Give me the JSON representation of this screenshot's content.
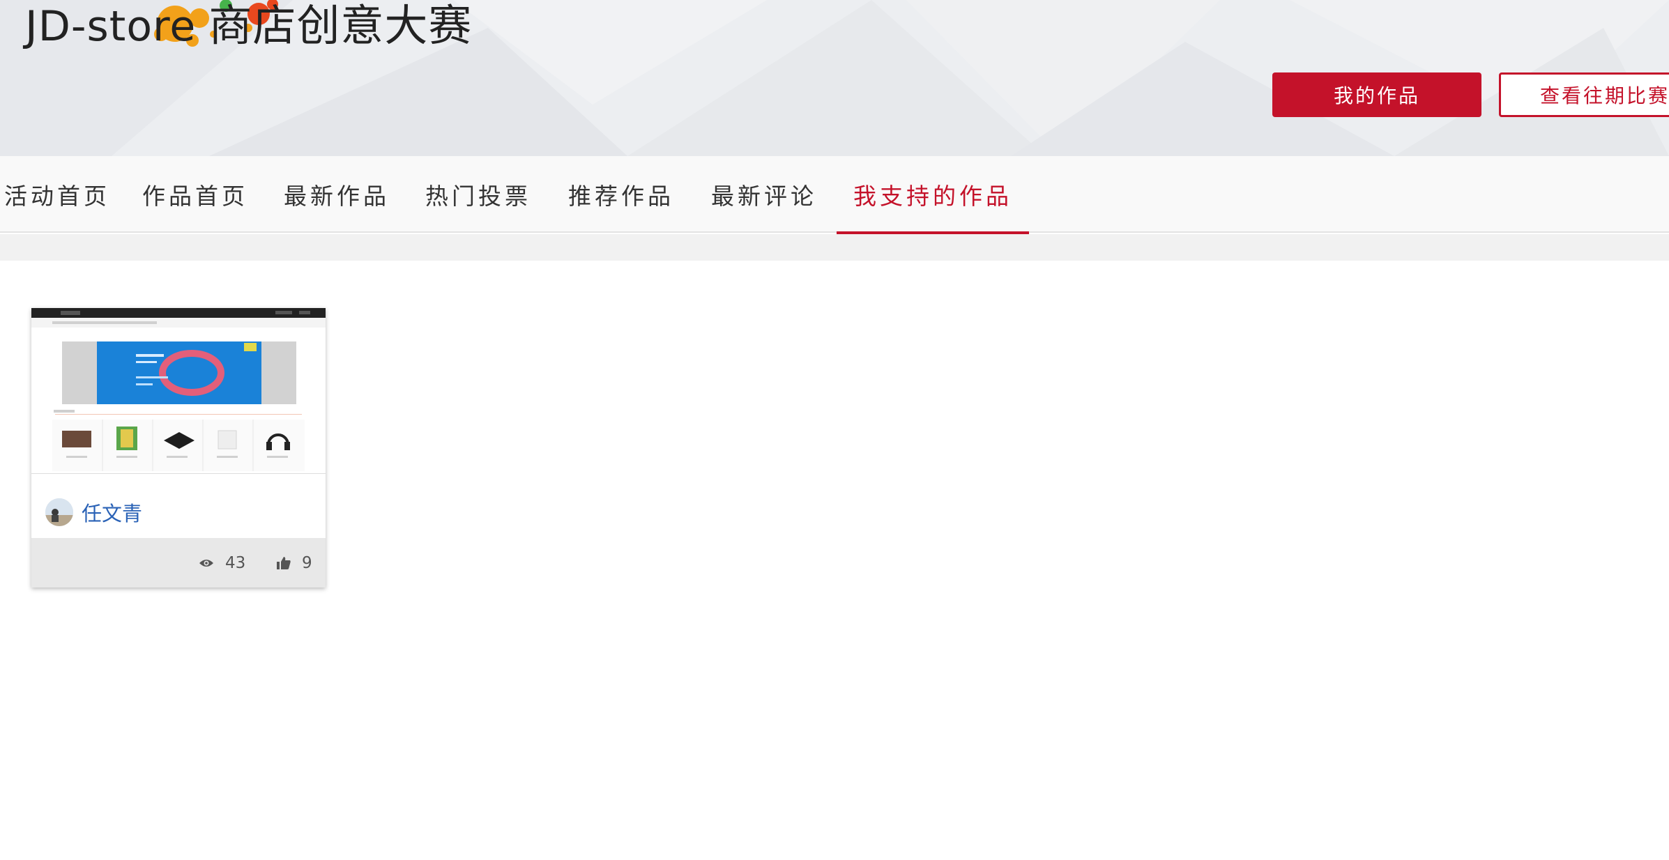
{
  "header": {
    "logo_prefix": "JD-store",
    "logo_suffix": "商店创意大赛",
    "my_works_button": "我的作品",
    "past_contests_button": "查看往期比赛"
  },
  "nav": {
    "items": [
      {
        "label": "活动首页"
      },
      {
        "label": "作品首页"
      },
      {
        "label": "最新作品"
      },
      {
        "label": "热门投票"
      },
      {
        "label": "推荐作品"
      },
      {
        "label": "最新评论"
      },
      {
        "label": "我支持的作品"
      }
    ],
    "active_index": 6
  },
  "works": [
    {
      "author": "任文青",
      "views": "43",
      "likes": "9"
    }
  ],
  "colors": {
    "accent": "#c4122a",
    "link": "#2a62b6",
    "nav_text": "#333333"
  },
  "icons": {
    "views": "eye-icon",
    "likes": "thumbs-up-icon"
  }
}
